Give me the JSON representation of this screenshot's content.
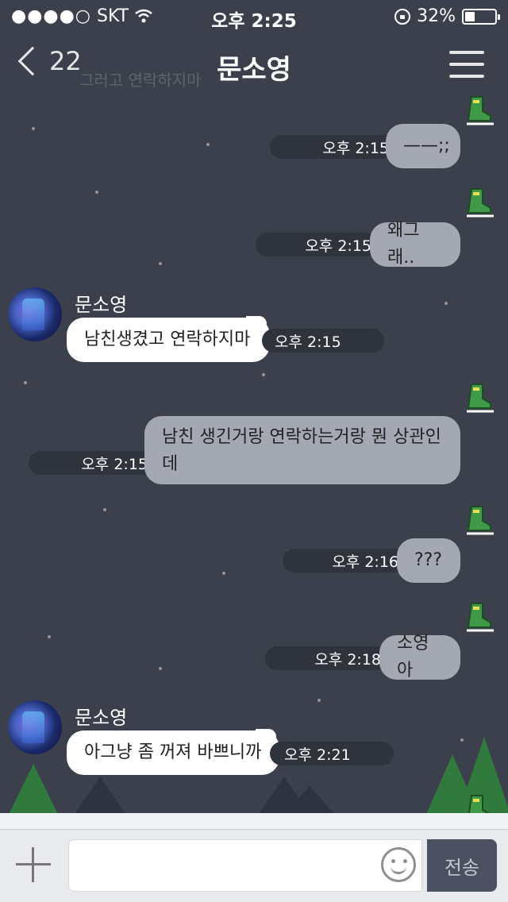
{
  "status_bar": {
    "signal_dots": "●●●●○",
    "carrier": "SKT",
    "time": "오후 2:25",
    "battery_percent": "32%",
    "battery_level": 0.32
  },
  "nav": {
    "back_count": "22",
    "title": "문소영",
    "ghost_preview": "그러고 연락하지마"
  },
  "messages": [
    {
      "direction": "out",
      "text": "——;;",
      "time": "오후 2:15"
    },
    {
      "direction": "out",
      "text": "왜그래..",
      "time": "오후 2:15"
    },
    {
      "direction": "in",
      "sender": "문소영",
      "text": "남친생겼고 연락하지마",
      "time": "오후 2:15"
    },
    {
      "direction": "out",
      "text": "남친 생긴거랑 연락하는거랑 뭔 상관인데",
      "time": "오후 2:15"
    },
    {
      "direction": "out",
      "text": "???",
      "time": "오후 2:16"
    },
    {
      "direction": "out",
      "text": "소영아",
      "time": "오후 2:18"
    },
    {
      "direction": "in",
      "sender": "문소영",
      "text": "아그냥 좀 꺼져 바쁘니까",
      "time": "오후 2:21"
    }
  ],
  "input": {
    "send_label": "전송",
    "placeholder": ""
  },
  "colors": {
    "background": "#3b404c",
    "outgoing_bubble": "#a4a8b3",
    "incoming_bubble": "#ffffff",
    "skate_green": "#3f9a48"
  }
}
